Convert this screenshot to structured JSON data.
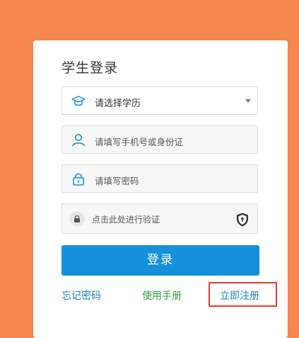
{
  "form": {
    "title": "学生登录",
    "education_select": {
      "selected": "请选择学历",
      "icon": "graduation-cap-icon"
    },
    "account_field": {
      "placeholder": "请填写手机号或身份证",
      "icon": "user-icon"
    },
    "password_field": {
      "placeholder": "请填写密码",
      "icon": "lock-icon"
    },
    "verification": {
      "label": "点击此处进行验证",
      "icon": "lock-icon",
      "badge_icon": "shield-icon"
    },
    "login_button": "登录",
    "links": {
      "forgot_password": "忘记密码",
      "user_manual": "使用手册",
      "register_now": "立即注册"
    }
  },
  "colors": {
    "background": "#F5864E",
    "card": "#FFFFFF",
    "primary": "#1690DB",
    "link_blue": "#1B7FC4",
    "link_green": "#2D9E3F",
    "highlight": "#E23B2E"
  }
}
